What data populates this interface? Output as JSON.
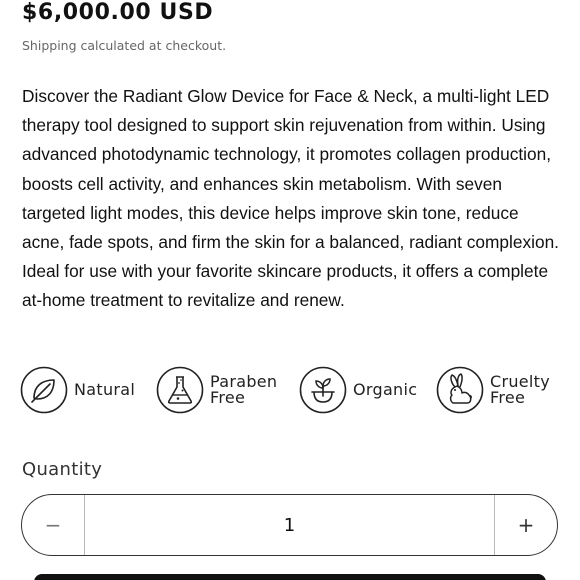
{
  "product": {
    "price": "$6,000.00 USD",
    "shipping_note": "Shipping calculated at checkout.",
    "description": "Discover the Radiant Glow Device for Face & Neck, a multi-light LED therapy tool designed to support skin rejuvenation from within. Using advanced photodynamic technology, it promotes collagen production, boosts cell activity, and enhances skin metabolism. With seven targeted light modes, this device helps improve skin tone, reduce acne, fade spots, and firm the skin for a balanced, radiant complexion. Ideal for use with your favorite skincare products, it offers a complete at-home treatment to revitalize and renew."
  },
  "badges": [
    {
      "icon": "leaf-icon",
      "line1": "Natural",
      "line2": ""
    },
    {
      "icon": "flask-icon",
      "line1": "Paraben",
      "line2": "Free"
    },
    {
      "icon": "plant-icon",
      "line1": "Organic",
      "line2": ""
    },
    {
      "icon": "rabbit-icon",
      "line1": "Cruelty",
      "line2": "Free"
    }
  ],
  "quantity": {
    "label": "Quantity",
    "value": "1",
    "decrement_label": "−",
    "increment_label": "+"
  }
}
